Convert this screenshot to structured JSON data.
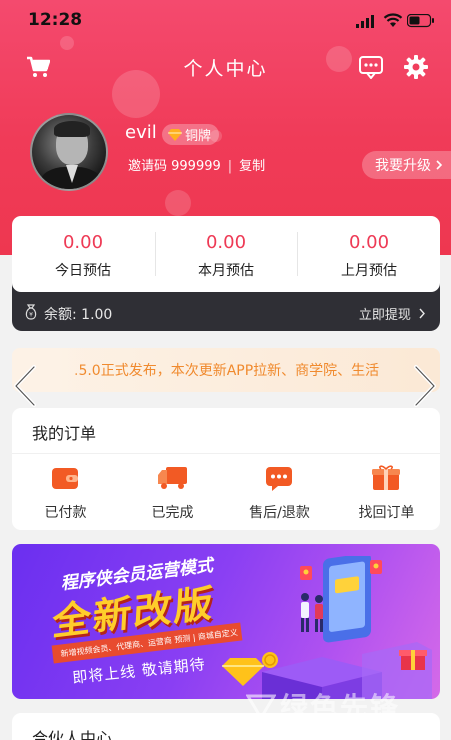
{
  "status_bar": {
    "time": "12:28"
  },
  "header": {
    "title": "个人中心"
  },
  "profile": {
    "username": "evil",
    "level_badge": "铜牌",
    "invite_label": "邀请码 999999",
    "copy_label": "复制",
    "upgrade_label": "我要升级"
  },
  "earnings": [
    {
      "value": "0.00",
      "label": "今日预估"
    },
    {
      "value": "0.00",
      "label": "本月预估"
    },
    {
      "value": "0.00",
      "label": "上月预估"
    }
  ],
  "balance": {
    "label": "余额: 1.00",
    "withdraw_label": "立即提现"
  },
  "notice": {
    "text": ".5.0正式发布，本次更新APP拉新、商学院、生活"
  },
  "orders": {
    "title": "我的订单",
    "items": [
      {
        "label": "已付款",
        "icon": "wallet-icon"
      },
      {
        "label": "已完成",
        "icon": "truck-icon"
      },
      {
        "label": "售后/退款",
        "icon": "chat-icon"
      },
      {
        "label": "找回订单",
        "icon": "gift-box-icon"
      }
    ]
  },
  "banner": {
    "title": "程序侠会员运营模式",
    "headline": "全新改版",
    "ribbon": "新增视频会员、代理商、运营商  预测 | 商城自定义",
    "subtitle": "即将上线  敬请期待"
  },
  "watermark": "绿色先锋",
  "partner": {
    "title": "合伙人中心"
  },
  "colors": {
    "brand": "#f03b58",
    "accent_orange": "#f08a2e",
    "balance_bg": "#2f2f35"
  }
}
